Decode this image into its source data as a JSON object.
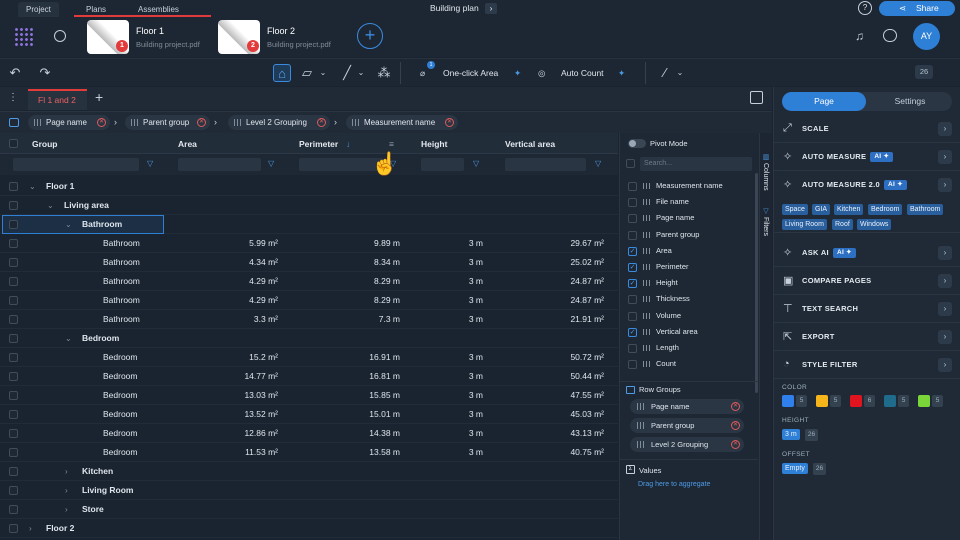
{
  "top_tabs": {
    "project": "Project",
    "plans": "Plans",
    "assemblies": "Assemblies"
  },
  "title": {
    "text": "Building plan",
    "chevron": "›"
  },
  "share": {
    "label": "Share",
    "help": "?"
  },
  "files": [
    {
      "name": "Floor 1",
      "sub": "Building project.pdf",
      "badge": "1"
    },
    {
      "name": "Floor 2",
      "sub": "Building project.pdf",
      "badge": "2"
    }
  ],
  "user": {
    "initials": "AY"
  },
  "toolbar": {
    "one_click": "One-click Area",
    "auto_count": "Auto Count",
    "zoom": "26"
  },
  "table_tab": {
    "label": "Fl 1 and 2",
    "add": "+"
  },
  "group_chips": [
    {
      "label": "Page name"
    },
    {
      "label": "Parent group"
    },
    {
      "label": "Level 2 Grouping"
    },
    {
      "label": "Measurement name"
    }
  ],
  "columns": {
    "group": "Group",
    "area": "Area",
    "perimeter": "Perimeter",
    "height": "Height",
    "vertical_area": "Vertical area"
  },
  "rows": [
    {
      "group": "Floor 1",
      "level": 0,
      "expand": "⌄",
      "area": "",
      "perimeter": "",
      "height": "",
      "varea": ""
    },
    {
      "group": "Living area",
      "level": 1,
      "expand": "⌄",
      "area": "",
      "perimeter": "",
      "height": "",
      "varea": ""
    },
    {
      "group": "Bathroom",
      "level": 2,
      "expand": "⌄",
      "area": "",
      "perimeter": "",
      "height": "",
      "varea": ""
    },
    {
      "group": "Bathroom",
      "level": 3,
      "expand": "",
      "area": "5.99 m²",
      "perimeter": "9.89 m",
      "height": "3 m",
      "varea": "29.67 m²"
    },
    {
      "group": "Bathroom",
      "level": 3,
      "expand": "",
      "area": "4.34 m²",
      "perimeter": "8.34 m",
      "height": "3 m",
      "varea": "25.02 m²"
    },
    {
      "group": "Bathroom",
      "level": 3,
      "expand": "",
      "area": "4.29 m²",
      "perimeter": "8.29 m",
      "height": "3 m",
      "varea": "24.87 m²"
    },
    {
      "group": "Bathroom",
      "level": 3,
      "expand": "",
      "area": "4.29 m²",
      "perimeter": "8.29 m",
      "height": "3 m",
      "varea": "24.87 m²"
    },
    {
      "group": "Bathroom",
      "level": 3,
      "expand": "",
      "area": "3.3 m²",
      "perimeter": "7.3 m",
      "height": "3 m",
      "varea": "21.91 m²"
    },
    {
      "group": "Bedroom",
      "level": 2,
      "expand": "⌄",
      "area": "",
      "perimeter": "",
      "height": "",
      "varea": ""
    },
    {
      "group": "Bedroom",
      "level": 3,
      "expand": "",
      "area": "15.2 m²",
      "perimeter": "16.91 m",
      "height": "3 m",
      "varea": "50.72 m²"
    },
    {
      "group": "Bedroom",
      "level": 3,
      "expand": "",
      "area": "14.77 m²",
      "perimeter": "16.81 m",
      "height": "3 m",
      "varea": "50.44 m²"
    },
    {
      "group": "Bedroom",
      "level": 3,
      "expand": "",
      "area": "13.03 m²",
      "perimeter": "15.85 m",
      "height": "3 m",
      "varea": "47.55 m²"
    },
    {
      "group": "Bedroom",
      "level": 3,
      "expand": "",
      "area": "13.52 m²",
      "perimeter": "15.01 m",
      "height": "3 m",
      "varea": "45.03 m²"
    },
    {
      "group": "Bedroom",
      "level": 3,
      "expand": "",
      "area": "12.86 m²",
      "perimeter": "14.38 m",
      "height": "3 m",
      "varea": "43.13 m²"
    },
    {
      "group": "Bedroom",
      "level": 3,
      "expand": "",
      "area": "11.53 m²",
      "perimeter": "13.58 m",
      "height": "3 m",
      "varea": "40.75 m²"
    },
    {
      "group": "Kitchen",
      "level": 2,
      "expand": "›",
      "area": "",
      "perimeter": "",
      "height": "",
      "varea": ""
    },
    {
      "group": "Living Room",
      "level": 2,
      "expand": "›",
      "area": "",
      "perimeter": "",
      "height": "",
      "varea": ""
    },
    {
      "group": "Store",
      "level": 2,
      "expand": "›",
      "area": "",
      "perimeter": "",
      "height": "",
      "varea": ""
    },
    {
      "group": "Floor 2",
      "level": 0,
      "expand": "›",
      "area": "",
      "perimeter": "",
      "height": "",
      "varea": ""
    }
  ],
  "side": {
    "pivot": "Pivot Mode",
    "search": "Search...",
    "columns": [
      {
        "label": "Measurement name",
        "checked": false
      },
      {
        "label": "File name",
        "checked": false
      },
      {
        "label": "Page name",
        "checked": false
      },
      {
        "label": "Parent group",
        "checked": false
      },
      {
        "label": "Area",
        "checked": true
      },
      {
        "label": "Perimeter",
        "checked": true
      },
      {
        "label": "Height",
        "checked": true
      },
      {
        "label": "Thickness",
        "checked": false
      },
      {
        "label": "Volume",
        "checked": false
      },
      {
        "label": "Vertical area",
        "checked": true
      },
      {
        "label": "Length",
        "checked": false
      },
      {
        "label": "Count",
        "checked": false
      }
    ],
    "row_groups_title": "Row Groups",
    "row_groups": [
      "Page name",
      "Parent group",
      "Level 2 Grouping"
    ],
    "values_title": "Values",
    "drag_hint": "Drag here to aggregate",
    "vtab_columns": "Columns",
    "vtab_filters": "Filters"
  },
  "right_panel": {
    "tab_page": "Page",
    "tab_settings": "Settings",
    "scale": "SCALE",
    "auto_measure": "AUTO MEASURE",
    "auto_measure2": "AUTO MEASURE 2.0",
    "ai_badge": "AI",
    "tags": [
      "Space",
      "GIA",
      "Kitchen",
      "Bedroom",
      "Bathroom",
      "Living Room",
      "Roof",
      "Windows"
    ],
    "ask_ai": "ASK AI",
    "compare": "COMPARE PAGES",
    "text_search": "TEXT SEARCH",
    "export": "EXPORT",
    "style_filter": "STYLE FILTER",
    "color_label": "COLOR",
    "colors": [
      {
        "hex": "#2f80ed",
        "count": "5"
      },
      {
        "hex": "#f5b51b",
        "count": "5"
      },
      {
        "hex": "#e0141e",
        "count": "6"
      },
      {
        "hex": "#1e6b8c",
        "count": "5"
      },
      {
        "hex": "#7ad53a",
        "count": "5"
      }
    ],
    "height_label": "HEIGHT",
    "height_value": "3 m",
    "height_count": "26",
    "offset_label": "OFFSET",
    "offset_value": "Empty",
    "offset_count": "26"
  }
}
